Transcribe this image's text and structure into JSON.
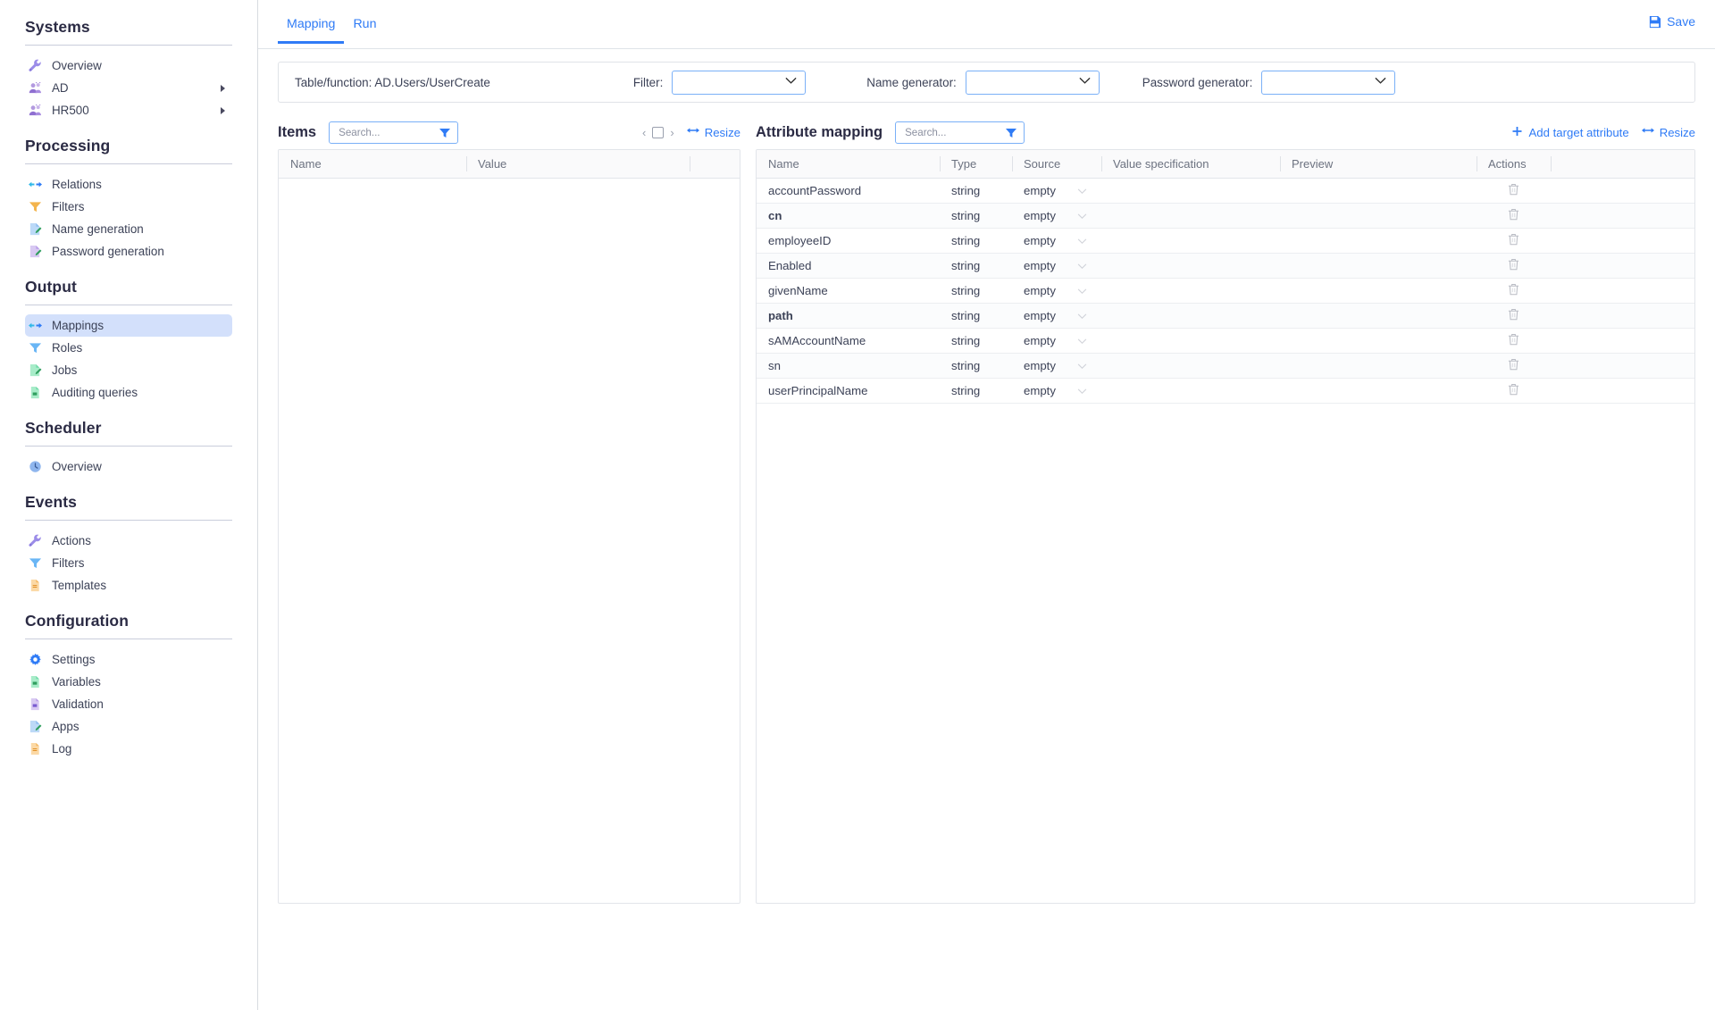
{
  "sidebar": {
    "sections": [
      {
        "title": "Systems",
        "items": [
          {
            "label": "Overview",
            "icon": "wrench-icon",
            "expandable": false
          },
          {
            "label": "AD",
            "icon": "users-icon",
            "expandable": true
          },
          {
            "label": "HR500",
            "icon": "users-icon",
            "expandable": true
          }
        ]
      },
      {
        "title": "Processing",
        "items": [
          {
            "label": "Relations",
            "icon": "arrows-icon",
            "expandable": false
          },
          {
            "label": "Filters",
            "icon": "funnel-icon",
            "expandable": false
          },
          {
            "label": "Name generation",
            "icon": "document-pencil-icon",
            "expandable": false
          },
          {
            "label": "Password generation",
            "icon": "document-pencil-icon",
            "expandable": false
          }
        ]
      },
      {
        "title": "Output",
        "items": [
          {
            "label": "Mappings",
            "icon": "arrows-icon",
            "expandable": false,
            "selected": true
          },
          {
            "label": "Roles",
            "icon": "funnel-icon",
            "expandable": false
          },
          {
            "label": "Jobs",
            "icon": "document-pencil-icon",
            "expandable": false
          },
          {
            "label": "Auditing queries",
            "icon": "document-icon",
            "expandable": false
          }
        ]
      },
      {
        "title": "Scheduler",
        "items": [
          {
            "label": "Overview",
            "icon": "clock-icon",
            "expandable": false
          }
        ]
      },
      {
        "title": "Events",
        "items": [
          {
            "label": "Actions",
            "icon": "wrench-icon",
            "expandable": false
          },
          {
            "label": "Filters",
            "icon": "funnel-icon",
            "expandable": false
          },
          {
            "label": "Templates",
            "icon": "document-icon",
            "expandable": false
          }
        ]
      },
      {
        "title": "Configuration",
        "items": [
          {
            "label": "Settings",
            "icon": "gear-icon",
            "expandable": false
          },
          {
            "label": "Variables",
            "icon": "document-icon",
            "expandable": false
          },
          {
            "label": "Validation",
            "icon": "document-icon",
            "expandable": false
          },
          {
            "label": "Apps",
            "icon": "document-pencil-icon",
            "expandable": false
          },
          {
            "label": "Log",
            "icon": "document-icon",
            "expandable": false
          }
        ]
      }
    ]
  },
  "tabs": [
    {
      "label": "Mapping",
      "active": true
    },
    {
      "label": "Run",
      "active": false
    }
  ],
  "toolbar": {
    "save_label": "Save"
  },
  "infobar": {
    "table_function_label": "Table/function: AD.Users/UserCreate",
    "filter_label": "Filter:",
    "filter_value": "",
    "name_generator_label": "Name generator:",
    "name_generator_value": "",
    "password_generator_label": "Password generator:",
    "password_generator_value": ""
  },
  "items_panel": {
    "title": "Items",
    "search_placeholder": "Search...",
    "search_value": "",
    "resize_label": "Resize",
    "page_value": "",
    "columns": [
      "Name",
      "Value",
      ""
    ],
    "rows": []
  },
  "attribute_panel": {
    "title": "Attribute mapping",
    "search_placeholder": "Search...",
    "search_value": "",
    "add_target_attribute_label": "Add target attribute",
    "resize_label": "Resize",
    "columns": [
      "Name",
      "Type",
      "Source",
      "Value specification",
      "Preview",
      "Actions",
      ""
    ],
    "rows": [
      {
        "name": "accountPassword",
        "bold": false,
        "type": "string",
        "source": "empty",
        "value_specification": "",
        "preview": ""
      },
      {
        "name": "cn",
        "bold": true,
        "type": "string",
        "source": "empty",
        "value_specification": "",
        "preview": ""
      },
      {
        "name": "employeeID",
        "bold": false,
        "type": "string",
        "source": "empty",
        "value_specification": "",
        "preview": ""
      },
      {
        "name": "Enabled",
        "bold": false,
        "type": "string",
        "source": "empty",
        "value_specification": "",
        "preview": ""
      },
      {
        "name": "givenName",
        "bold": false,
        "type": "string",
        "source": "empty",
        "value_specification": "",
        "preview": ""
      },
      {
        "name": "path",
        "bold": true,
        "type": "string",
        "source": "empty",
        "value_specification": "",
        "preview": ""
      },
      {
        "name": "sAMAccountName",
        "bold": false,
        "type": "string",
        "source": "empty",
        "value_specification": "",
        "preview": ""
      },
      {
        "name": "sn",
        "bold": false,
        "type": "string",
        "source": "empty",
        "value_specification": "",
        "preview": ""
      },
      {
        "name": "userPrincipalName",
        "bold": false,
        "type": "string",
        "source": "empty",
        "value_specification": "",
        "preview": ""
      }
    ]
  },
  "colors": {
    "accent": "#2f7bf6",
    "selected_nav_bg": "#d3e0fb",
    "header_text": "#2b2b44",
    "body_text": "#3c4257",
    "border": "#e2e5ea"
  }
}
